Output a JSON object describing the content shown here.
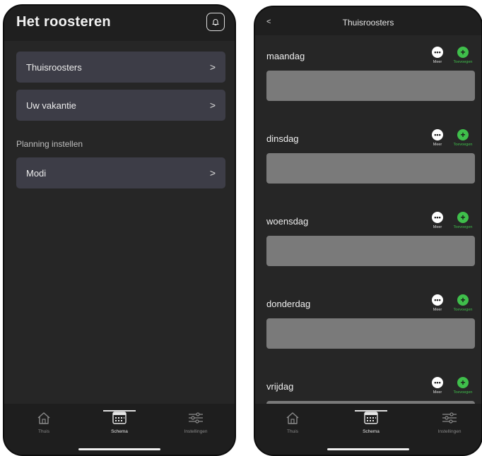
{
  "left": {
    "title": "Het roosteren",
    "menu": [
      {
        "label": "Thuisroosters"
      },
      {
        "label": "Uw vakantie"
      }
    ],
    "section_label": "Planning instellen",
    "modes": {
      "label": "Modi"
    },
    "tabs": [
      {
        "label": "Thuis",
        "icon": "home-icon"
      },
      {
        "label": "Schema",
        "icon": "calendar-icon"
      },
      {
        "label": "Instellingen",
        "icon": "sliders-icon"
      }
    ],
    "active_tab": "Schema"
  },
  "right": {
    "back": "<",
    "title": "Thuisroosters",
    "days": [
      {
        "name": "maandag"
      },
      {
        "name": "dinsdag"
      },
      {
        "name": "woensdag"
      },
      {
        "name": "donderdag"
      },
      {
        "name": "vrijdag"
      }
    ],
    "more_label": "Meer",
    "add_label": "Toevoegen",
    "more_glyph": "•••",
    "add_glyph": "+",
    "tabs": [
      {
        "label": "Thuis",
        "icon": "home-icon"
      },
      {
        "label": "Schema",
        "icon": "calendar-icon"
      },
      {
        "label": "Instellingen",
        "icon": "sliders-icon"
      }
    ],
    "active_tab": "Schema"
  },
  "colors": {
    "accent_green": "#3fbf4b",
    "card": "#3d3d47",
    "background": "#262626"
  }
}
